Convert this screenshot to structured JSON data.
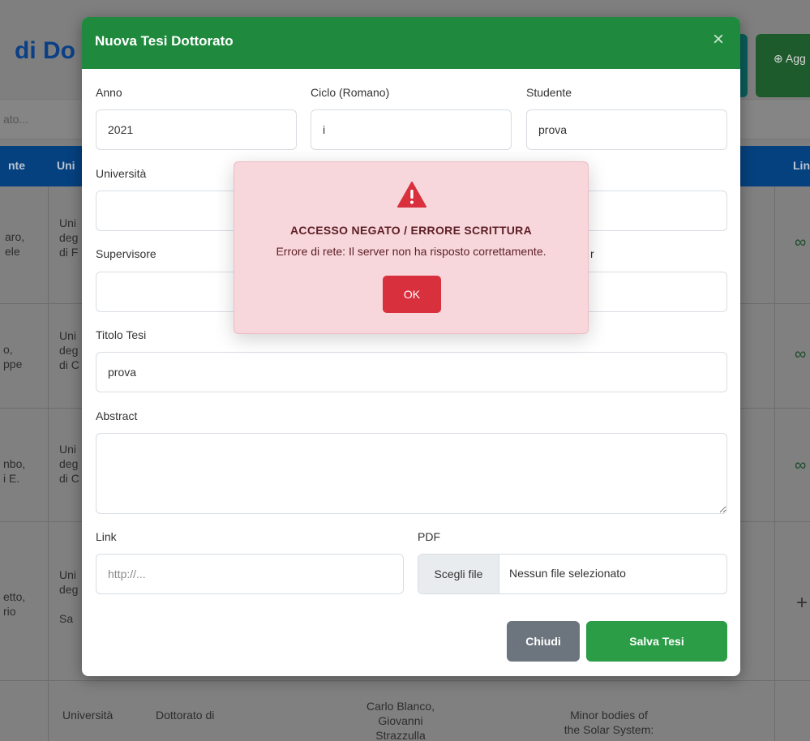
{
  "background": {
    "page_title_fragment": "di Do",
    "add_button_fragment": "Agg",
    "search_placeholder_fragment": "ato...",
    "table_headers": [
      "nte",
      "Uni",
      "Lin"
    ],
    "rows": [
      {
        "col1": "aro,\nele",
        "col2": "Uni\ndeg\ndi F"
      },
      {
        "col1": "o,\nppe",
        "col2": "Uni\ndeg\ndi C"
      },
      {
        "col1": "nbo,\ni E.",
        "col2": "Uni\ndeg\ndi C"
      },
      {
        "col1": "etto,\nrio",
        "col2": "Uni\ndeg\n\nSa"
      }
    ],
    "last_row": {
      "col2": "Università",
      "col3": "Dottorato di",
      "col4": "Carlo Blanco,\nGiovanni\nStrazzulla",
      "col6": "Minor bodies of\nthe Solar System:"
    }
  },
  "modal": {
    "title": "Nuova Tesi Dottorato",
    "close_symbol": "×",
    "fields": {
      "anno": {
        "label": "Anno",
        "value": "2021"
      },
      "ciclo": {
        "label": "Ciclo (Romano)",
        "value": "i"
      },
      "studente": {
        "label": "Studente",
        "value": "prova"
      },
      "universita": {
        "label": "Università",
        "value": ""
      },
      "supervisore": {
        "label": "Supervisore",
        "value": ""
      },
      "co_supervisor_fragment": {
        "label": "r",
        "value": ""
      },
      "titolo": {
        "label": "Titolo Tesi",
        "value": "prova"
      },
      "abstract": {
        "label": "Abstract",
        "value": ""
      },
      "link": {
        "label": "Link",
        "value": "",
        "placeholder": "http://..."
      },
      "pdf": {
        "label": "PDF",
        "button": "Scegli file",
        "status": "Nessun file selezionato"
      }
    },
    "buttons": {
      "close": "Chiudi",
      "save": "Salva Tesi"
    }
  },
  "alert": {
    "icon": "warning-triangle-icon",
    "title": "ACCESSO NEGATO / ERRORE SCRITTURA",
    "message": "Errore di rete: Il server non ha risposto correttamente.",
    "ok": "OK"
  },
  "colors": {
    "modal_header": "#1f8a3e",
    "save_button": "#2a9d46",
    "close_button": "#6c757d",
    "alert_bg": "#f7d7dc",
    "alert_ok": "#d9303e",
    "alert_icon": "#d9303e"
  }
}
